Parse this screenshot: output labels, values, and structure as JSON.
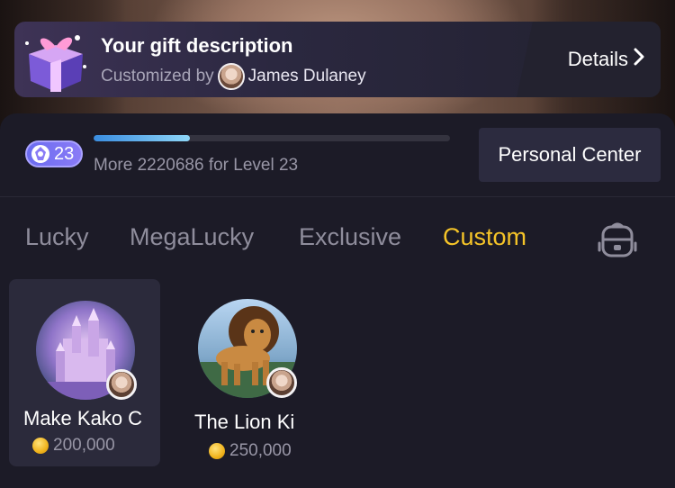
{
  "banner": {
    "title": "Your gift description",
    "customized_by_label": "Customized by",
    "creator_name": "James Dulaney",
    "details_label": "Details",
    "gift_icon": "gift-box-icon"
  },
  "level": {
    "badge_value": "23",
    "progress_fraction": 0.27,
    "progress_text": "More 2220686 for Level 23"
  },
  "personal_center_label": "Personal Center",
  "tabs": [
    {
      "label": "Lucky",
      "active": false
    },
    {
      "label": "MegaLucky",
      "active": false
    },
    {
      "label": "Exclusive",
      "active": false
    },
    {
      "label": "Custom",
      "active": true
    }
  ],
  "backpack_icon": "backpack-icon",
  "gifts": [
    {
      "name": "Make Kako C",
      "price": "200,000",
      "selected": true
    },
    {
      "name": "The Lion Ki",
      "price": "250,000",
      "selected": false
    }
  ],
  "colors": {
    "active_tab": "#f5c428",
    "panel_bg": "#1c1b27",
    "level_badge": "#7b74f3"
  }
}
